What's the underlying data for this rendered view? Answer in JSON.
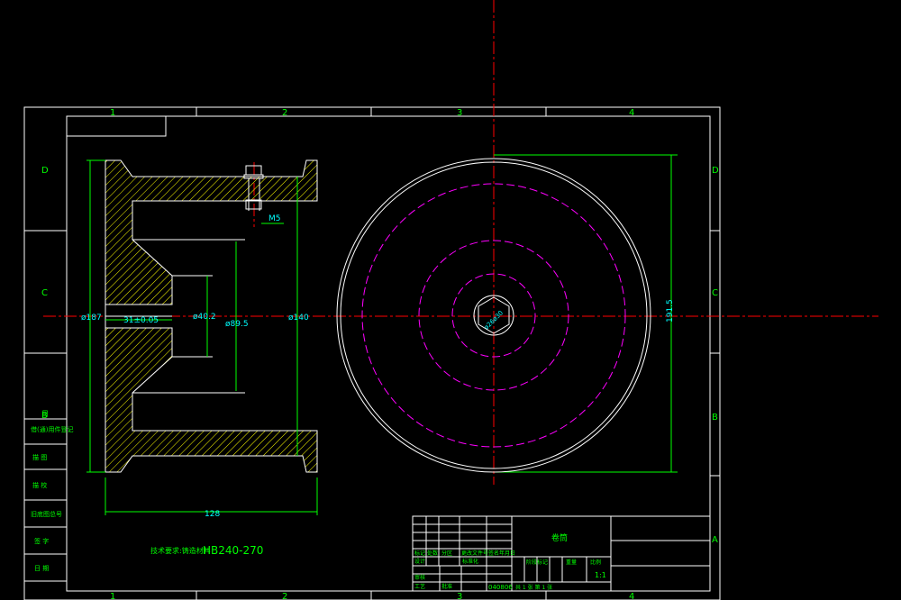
{
  "frame": {
    "zones_top": [
      "1",
      "2",
      "3",
      "4"
    ],
    "zones_bottom": [
      "1",
      "2",
      "3",
      "4"
    ],
    "zones_left": [
      "D",
      "C",
      "B"
    ],
    "zones_right": [
      "D",
      "C",
      "B",
      "A"
    ]
  },
  "dimensions": {
    "d187": "ø187",
    "tol31": "31±0.05",
    "d40": "ø40.2",
    "d89": "ø89.5",
    "d140": "ø140",
    "m5": "M5",
    "w128": "128",
    "h191": "191.5",
    "bore": "ø26⁠ø30"
  },
  "notes": {
    "tech_req_prefix": "技术要求:铸造材料",
    "tech_req_code": "HB240-270"
  },
  "left_column": {
    "labels": [
      "借(通)用件登记",
      "描 图",
      "描 校",
      "旧底图总号",
      "签 字",
      "日 期"
    ]
  },
  "title_block": {
    "part_name": "卷筒",
    "scale": "1:1",
    "drawing_no": "040806",
    "row_labels": [
      "标记",
      "处数",
      "分区",
      "更改文件号",
      "签名",
      "年月日"
    ],
    "col_labels": [
      "设计",
      "标准化",
      "审核",
      "工艺",
      "批准"
    ],
    "stage_label": "阶段标记",
    "weight_label": "重量",
    "scale_label": "比例",
    "sheet_label": "共 1 张  第 1 张"
  },
  "colors": {
    "background": "#000000",
    "frame": "#ffffff",
    "outline": "#ffffff",
    "center_line": "#ff0000",
    "hatch": "#ffff00",
    "dimension": "#00ff00",
    "dimension_text": "#00ffff",
    "hidden_circles": "#ff00ff",
    "text": "#00ff00"
  }
}
